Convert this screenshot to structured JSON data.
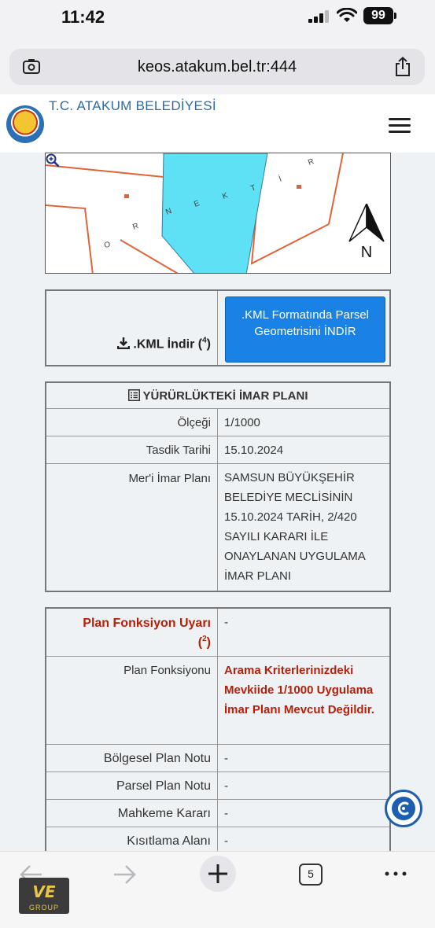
{
  "status": {
    "time": "11:42",
    "battery": "99"
  },
  "browser": {
    "url": "keos.atakum.bel.tr:444",
    "tab_count": "5"
  },
  "site": {
    "title": "T.C. ATAKUM BELEDİYESİ"
  },
  "map": {
    "labels": [
      "O",
      "R",
      "N",
      "E",
      "K",
      "T",
      "İ",
      "R"
    ],
    "north_label": "N"
  },
  "kml": {
    "label": ".KML İndir",
    "footnote": "4",
    "button_label": ".KML Formatında Parsel Geometrisini İNDİR"
  },
  "zoning": {
    "heading": "YÜRÜRLÜKTEKİ İMAR PLANI",
    "rows": [
      {
        "label": "Ölçeği",
        "value": "1/1000"
      },
      {
        "label": "Tasdik Tarihi",
        "value": "15.10.2024"
      },
      {
        "label": "Mer'i İmar Planı",
        "value": "SAMSUN BÜYÜKŞEHİR BELEDİYE MECLİSİNİN 15.10.2024 TARİH, 2/420 SAYILI KARARI İLE ONAYLANAN UYGULAMA İMAR PLANI"
      }
    ]
  },
  "plan": {
    "warning_label": "Plan Fonksiyon Uyarı",
    "warning_footnote": "2",
    "warning_value": "-",
    "function_label": "Plan Fonksiyonu",
    "function_value": "Arama Kriterlerinizdeki Mevkiide 1/1000 Uygulama İmar Planı Mevcut Değildir.",
    "rows": [
      {
        "label": "Bölgesel Plan Notu",
        "value": "-"
      },
      {
        "label": "Parsel Plan Notu",
        "value": "-"
      },
      {
        "label": "Mahkeme Kararı",
        "value": "-"
      },
      {
        "label": "Kısıtlama Alanı",
        "value": "-"
      }
    ]
  },
  "watermark": {
    "logo_text": "VE",
    "logo_sub": "GROUP"
  },
  "colors": {
    "accent": "#1a82e4",
    "site_title": "#2f6aa3",
    "warning": "#b5200b",
    "map_water": "#5ee0f5",
    "map_parcel": "#e0643a"
  }
}
